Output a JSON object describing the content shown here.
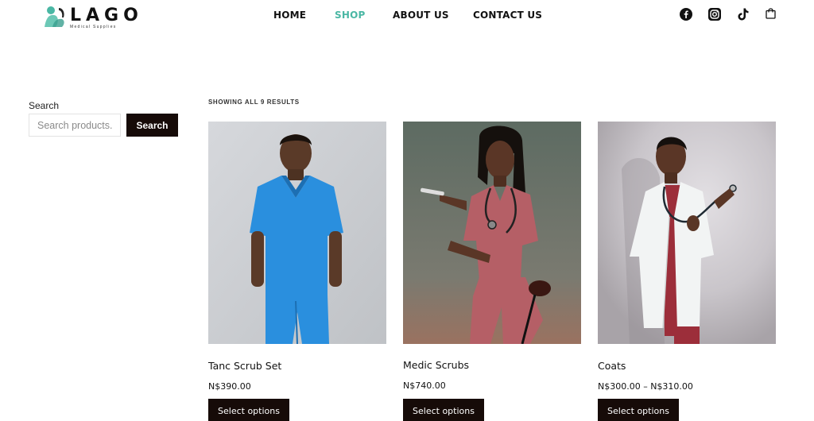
{
  "brand": {
    "name": "LAGO",
    "tagline": "Medical Supplies",
    "accent_color": "#4ab7a4"
  },
  "nav": {
    "items": [
      {
        "label": "HOME",
        "active": false
      },
      {
        "label": "SHOP",
        "active": true
      },
      {
        "label": "ABOUT US",
        "active": false
      },
      {
        "label": "CONTACT US",
        "active": false
      }
    ]
  },
  "social_icons": [
    "facebook-icon",
    "instagram-icon",
    "tiktok-icon",
    "cart-icon"
  ],
  "sidebar": {
    "search_label": "Search",
    "search_placeholder": "Search products...",
    "search_button": "Search"
  },
  "shop": {
    "results_count": "SHOWING ALL 9 RESULTS",
    "products": [
      {
        "name": "Tanc Scrub Set",
        "price": "N$390.00",
        "button": "Select options"
      },
      {
        "name": "Medic Scrubs",
        "price": "N$740.00",
        "button": "Select options"
      },
      {
        "name": "Coats",
        "price": "N$300.00 – N$310.00",
        "button": "Select options"
      }
    ]
  },
  "colors": {
    "button_bg": "#160b08",
    "text": "#111111"
  }
}
